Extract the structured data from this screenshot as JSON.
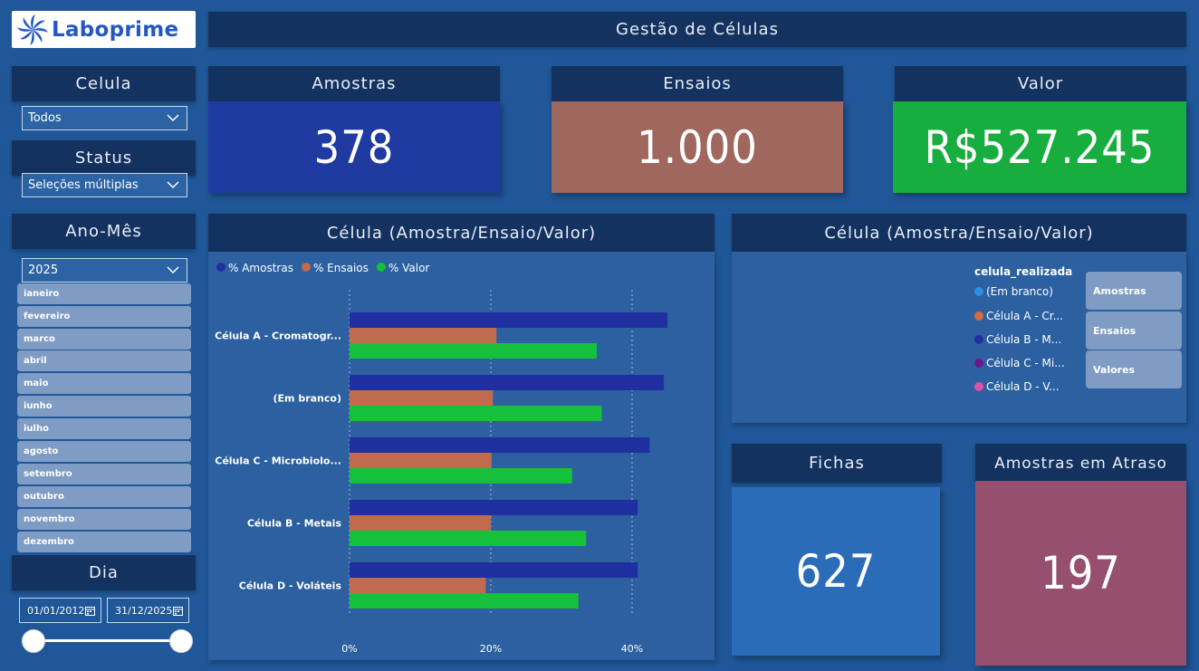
{
  "header": {
    "logo_text": "Laboprime",
    "title": "Gestão de Células"
  },
  "filters": {
    "celula": {
      "label": "Celula",
      "value": "Todos"
    },
    "status": {
      "label": "Status",
      "value": "Seleções múltiplas"
    },
    "ano_mes": {
      "label": "Ano-Mês",
      "value": "2025",
      "months": [
        "ianeiro",
        "fevereiro",
        "marco",
        "abril",
        "maio",
        "iunho",
        "iulho",
        "agosto",
        "setembro",
        "outubro",
        "novembro",
        "dezembro"
      ]
    },
    "dia": {
      "label": "Dia",
      "start": "01/01/2012",
      "end": "31/12/2025"
    }
  },
  "kpis": {
    "amostras": {
      "label": "Amostras",
      "value": "378",
      "color": "#1f3aa0"
    },
    "ensaios": {
      "label": "Ensaios",
      "value": "1.000",
      "color": "#a0675f"
    },
    "valor": {
      "label": "Valor",
      "value": "R$527.245",
      "color": "#17ad3f"
    },
    "fichas": {
      "label": "Fichas",
      "value": "627",
      "color": "#2a6cb8"
    },
    "atraso": {
      "label": "Amostras em Atraso",
      "value": "197",
      "color": "#964f6f"
    }
  },
  "chart_title": "Célula (Amostra/Ensaio/Valor)",
  "chart_data": {
    "type": "bar",
    "orientation": "horizontal",
    "categories": [
      "Célula A - Cromatogr...",
      "(Em branco)",
      "Célula C - Microbiolo...",
      "Célula B - Metais",
      "Célula D - Voláteis"
    ],
    "series": [
      {
        "name": "% Amostras",
        "color": "#1f2fa0",
        "values": [
          45,
          44.5,
          42.5,
          40.8,
          40.8
        ]
      },
      {
        "name": "% Ensaios",
        "color": "#c06a4e",
        "values": [
          20.8,
          20.3,
          20.1,
          20.0,
          19.3
        ]
      },
      {
        "name": "% Valor",
        "color": "#17c03a",
        "values": [
          35,
          35.7,
          31.5,
          33.5,
          32.4
        ]
      }
    ],
    "x_ticks": [
      "0%",
      "20%",
      "40%"
    ],
    "xlim": [
      0,
      50
    ],
    "grid": true,
    "legend_position": "top-left"
  },
  "right_panel": {
    "title": "Célula (Amostra/Ensaio/Valor)",
    "legend_title": "celula_realizada",
    "legend": [
      {
        "label": "(Em branco)",
        "color": "#2f8ee6"
      },
      {
        "label": "Célula A - Cr...",
        "color": "#d9683e"
      },
      {
        "label": "Célula B - M...",
        "color": "#1f2fa0"
      },
      {
        "label": "Célula C - Mi...",
        "color": "#6a1b8a"
      },
      {
        "label": "Célula D - V...",
        "color": "#e052a8"
      }
    ],
    "buttons": [
      "Amostras",
      "Ensaios",
      "Valores"
    ]
  }
}
